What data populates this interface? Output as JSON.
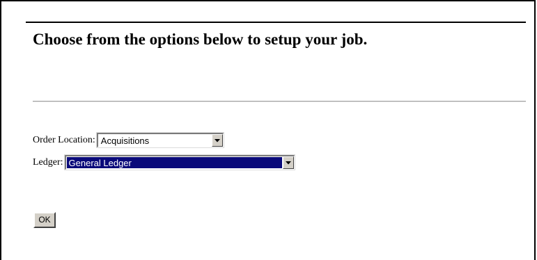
{
  "page": {
    "title": "Choose from the options below to setup your job."
  },
  "form": {
    "order_location": {
      "label": "Order Location:",
      "selected": "Acquisitions"
    },
    "ledger": {
      "label": "Ledger:",
      "selected": "General Ledger"
    },
    "ok_label": "OK"
  },
  "icons": {
    "dropdown_arrow": "chevron-down-icon"
  },
  "colors": {
    "selection_background": "#0a0a7a",
    "selection_text": "#ffffff",
    "button_face": "#d4d0c8"
  }
}
